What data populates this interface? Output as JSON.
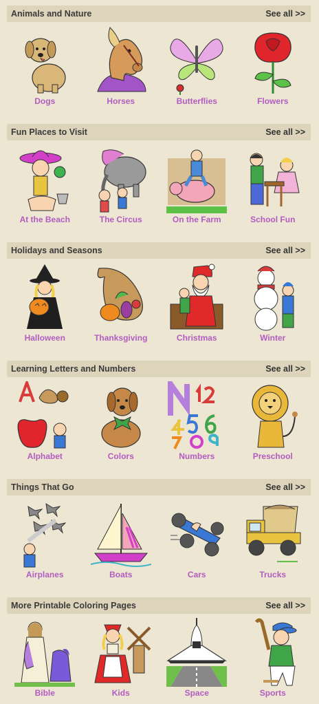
{
  "colors": {
    "accent": "#b25cc0",
    "header_bg": "#ddd4bb",
    "page_bg": "#ede6d3"
  },
  "sections": [
    {
      "title": "Animals and Nature",
      "see_all": "See all >>",
      "items": [
        {
          "label": "Dogs",
          "icon": "dog-icon"
        },
        {
          "label": "Horses",
          "icon": "horse-icon"
        },
        {
          "label": "Butterflies",
          "icon": "butterfly-icon"
        },
        {
          "label": "Flowers",
          "icon": "rose-icon"
        }
      ]
    },
    {
      "title": "Fun Places to Visit",
      "see_all": "See all >>",
      "items": [
        {
          "label": "At the Beach",
          "icon": "beach-girl-icon"
        },
        {
          "label": "The Circus",
          "icon": "circus-elephant-icon"
        },
        {
          "label": "On the Farm",
          "icon": "farm-pig-icon"
        },
        {
          "label": "School Fun",
          "icon": "school-kids-icon"
        }
      ]
    },
    {
      "title": "Holidays and Seasons",
      "see_all": "See all >>",
      "items": [
        {
          "label": "Halloween",
          "icon": "witch-pumpkin-icon"
        },
        {
          "label": "Thanksgiving",
          "icon": "cornucopia-icon"
        },
        {
          "label": "Christmas",
          "icon": "santa-icon"
        },
        {
          "label": "Winter",
          "icon": "snowman-icon"
        }
      ]
    },
    {
      "title": "Learning Letters and Numbers",
      "see_all": "See all >>",
      "items": [
        {
          "label": "Alphabet",
          "icon": "alphabet-apple-icon"
        },
        {
          "label": "Colors",
          "icon": "colors-dog-icon"
        },
        {
          "label": "Numbers",
          "icon": "numbers-icon"
        },
        {
          "label": "Preschool",
          "icon": "lion-icon"
        }
      ]
    },
    {
      "title": "Things That Go",
      "see_all": "See all >>",
      "items": [
        {
          "label": "Airplanes",
          "icon": "airplanes-icon"
        },
        {
          "label": "Boats",
          "icon": "sailboat-icon"
        },
        {
          "label": "Cars",
          "icon": "race-car-icon"
        },
        {
          "label": "Trucks",
          "icon": "dump-truck-icon"
        }
      ]
    },
    {
      "title": "More Printable Coloring Pages",
      "see_all": "See all >>",
      "items": [
        {
          "label": "Bible",
          "icon": "bible-figures-icon"
        },
        {
          "label": "Kids",
          "icon": "kids-windmill-icon"
        },
        {
          "label": "Space",
          "icon": "space-shuttle-icon"
        },
        {
          "label": "Sports",
          "icon": "baseball-player-icon"
        }
      ]
    }
  ]
}
